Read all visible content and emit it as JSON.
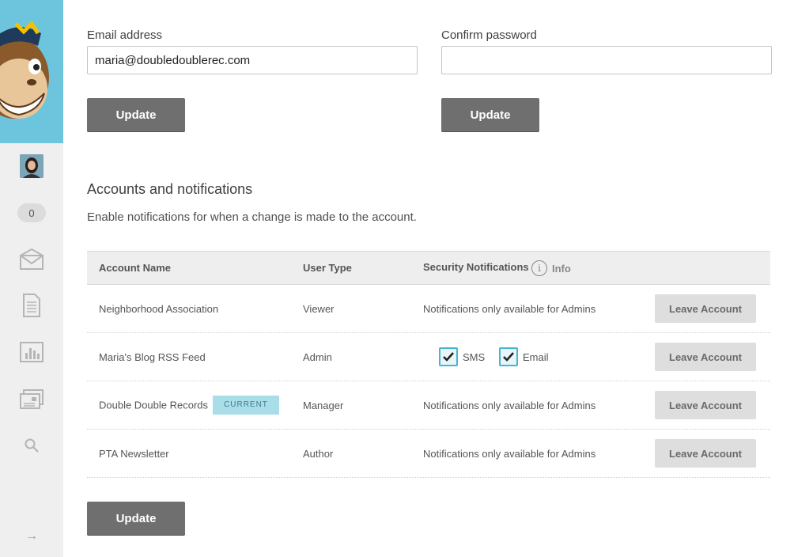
{
  "form": {
    "email_label": "Email address",
    "email_value": "maria@doubledoublerec.com",
    "confirm_label": "Confirm password",
    "confirm_value": "",
    "update_label": "Update"
  },
  "sidebar": {
    "notification_count": "0",
    "icons": [
      "logo-monkey",
      "avatar",
      "campaigns-envelope-icon",
      "templates-document-icon",
      "reports-chart-icon",
      "automation-icon",
      "search-icon",
      "collapse-arrow-icon"
    ],
    "collapse_glyph": "→"
  },
  "section": {
    "title": "Accounts and notifications",
    "description": "Enable notifications for when a change is made to the account."
  },
  "table": {
    "headers": {
      "account_name": "Account Name",
      "user_type": "User Type",
      "security_notifications": "Security Notifications",
      "info": "Info",
      "info_glyph": "i"
    },
    "rows": [
      {
        "name": "Neighborhood Association",
        "badge": "",
        "user_type": "Viewer",
        "notifications": "Notifications only available for Admins",
        "action": "Leave Account"
      },
      {
        "name": "Maria's Blog RSS Feed",
        "badge": "",
        "user_type": "Admin",
        "sms_label": "SMS",
        "sms_checked": true,
        "email_label": "Email",
        "email_checked": true,
        "action": "Leave Account"
      },
      {
        "name": "Double Double Records",
        "badge": "CURRENT",
        "user_type": "Manager",
        "notifications": "Notifications only available for Admins",
        "action": "Leave Account"
      },
      {
        "name": "PTA Newsletter",
        "badge": "",
        "user_type": "Author",
        "notifications": "Notifications only available for Admins",
        "action": "Leave Account"
      }
    ]
  },
  "footer": {
    "update_label": "Update"
  },
  "colors": {
    "sidebar_accent": "#6cc5dc",
    "button_dark": "#6f6f6f",
    "checkbox_border": "#45b5d0",
    "badge_bg": "#a9dde8"
  }
}
